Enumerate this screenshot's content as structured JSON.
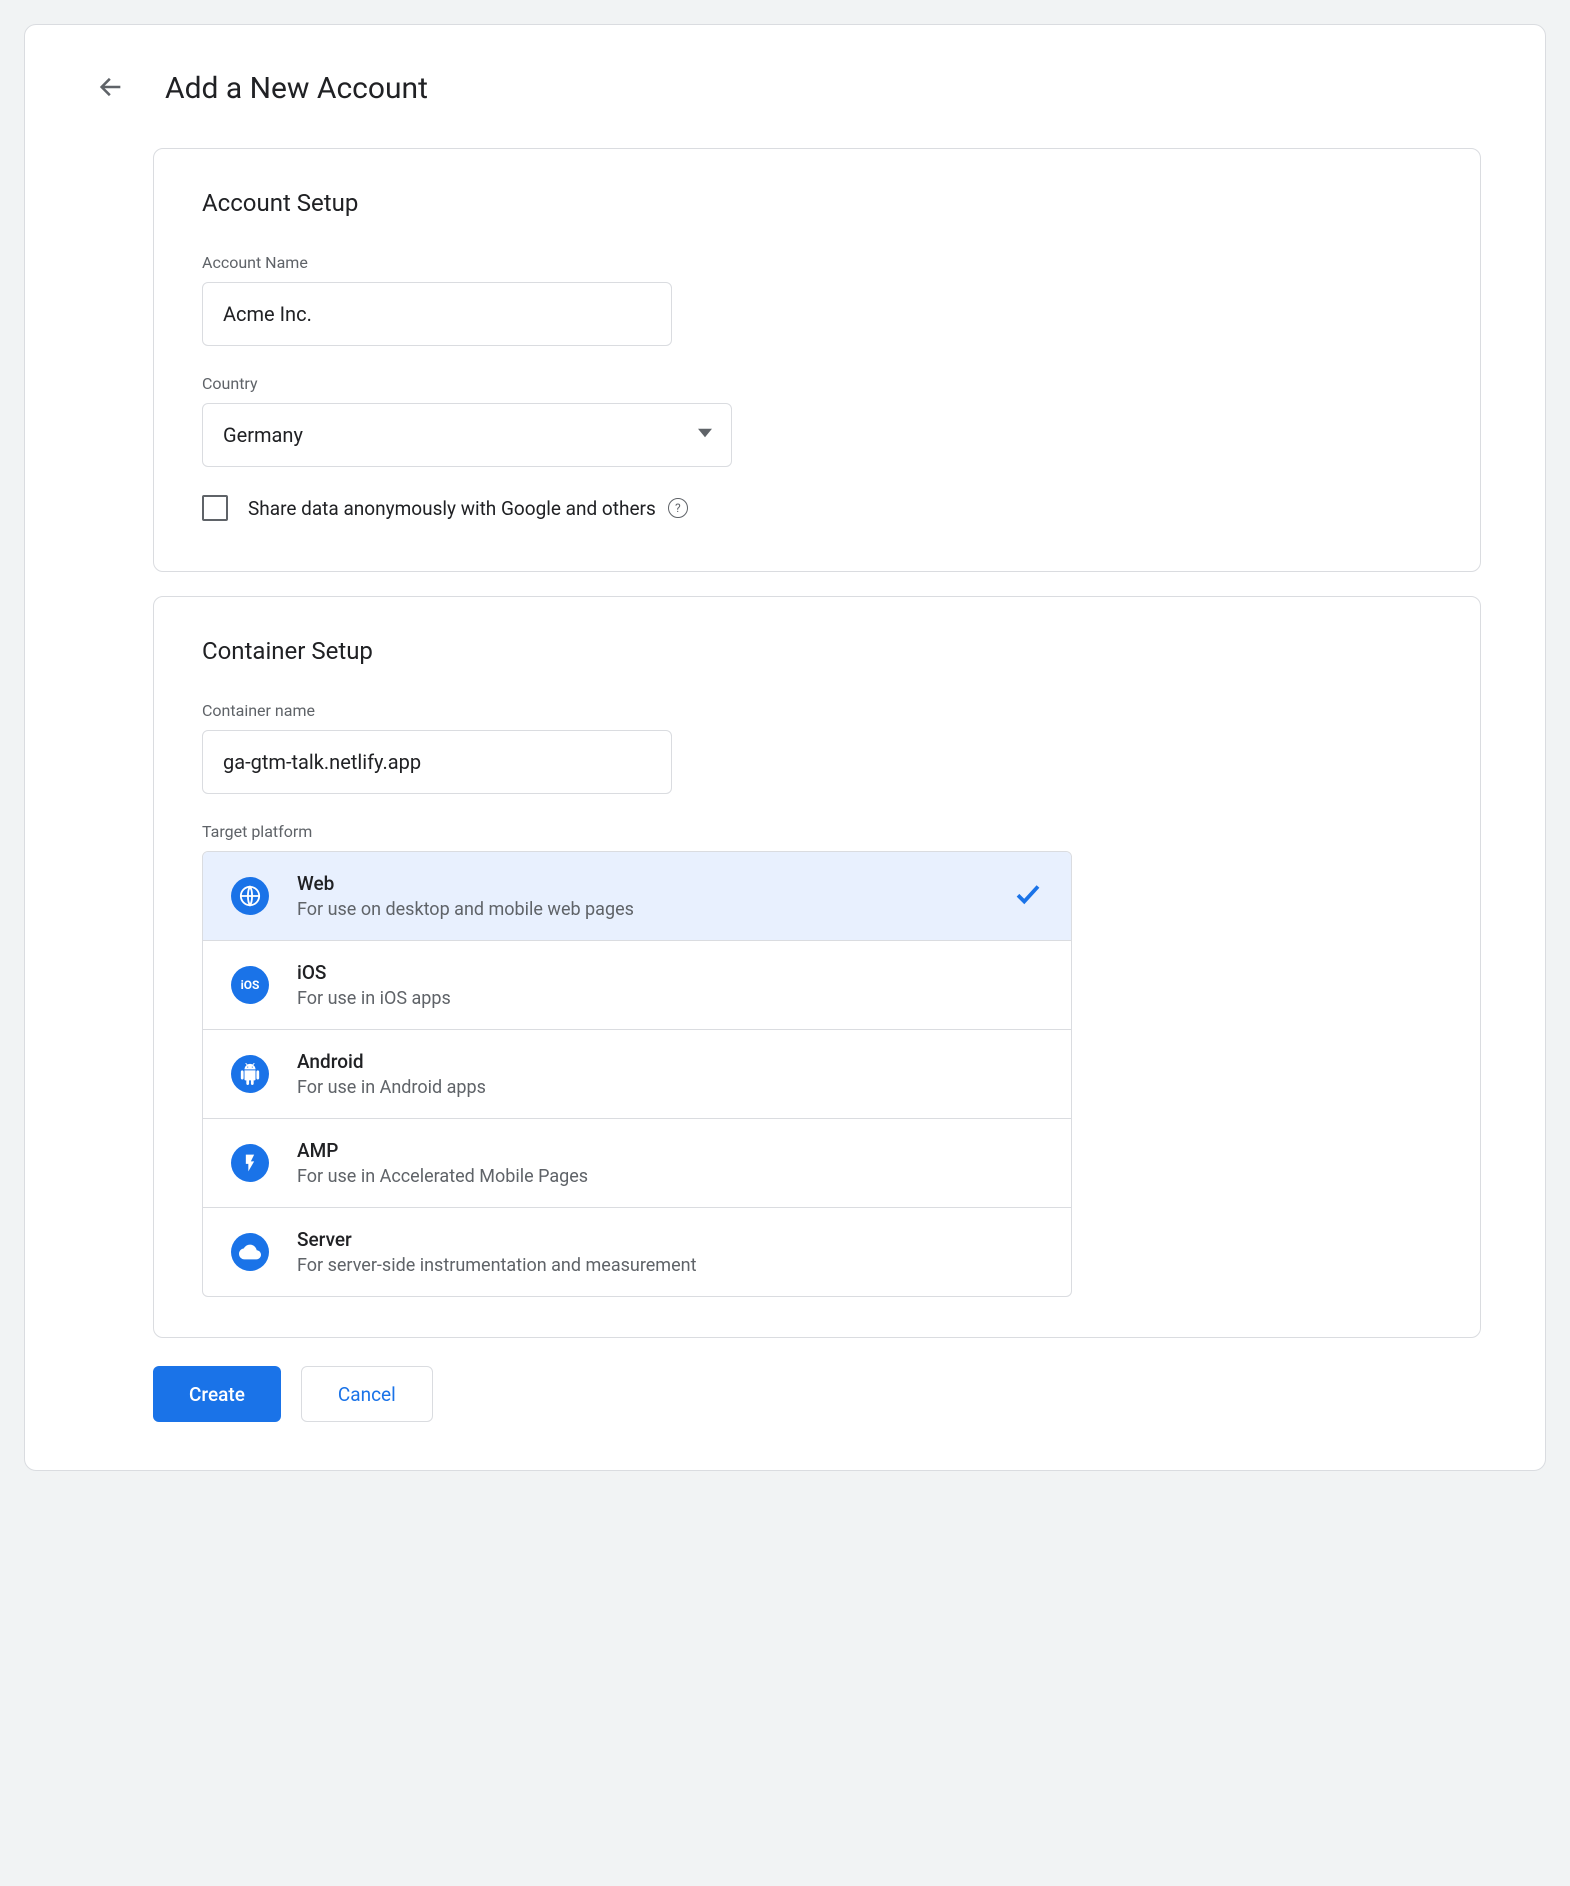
{
  "header": {
    "title": "Add a New Account"
  },
  "account_setup": {
    "heading": "Account Setup",
    "account_name_label": "Account Name",
    "account_name_value": "Acme Inc.",
    "country_label": "Country",
    "country_value": "Germany",
    "share_checkbox_label": "Share data anonymously with Google and others",
    "share_checked": false
  },
  "container_setup": {
    "heading": "Container Setup",
    "container_name_label": "Container name",
    "container_name_value": "ga-gtm-talk.netlify.app",
    "target_platform_label": "Target platform",
    "platforms": [
      {
        "id": "web",
        "title": "Web",
        "desc": "For use on desktop and mobile web pages",
        "selected": true,
        "icon": "globe"
      },
      {
        "id": "ios",
        "title": "iOS",
        "desc": "For use in iOS apps",
        "selected": false,
        "icon": "ios"
      },
      {
        "id": "android",
        "title": "Android",
        "desc": "For use in Android apps",
        "selected": false,
        "icon": "android"
      },
      {
        "id": "amp",
        "title": "AMP",
        "desc": "For use in Accelerated Mobile Pages",
        "selected": false,
        "icon": "bolt"
      },
      {
        "id": "server",
        "title": "Server",
        "desc": "For server-side instrumentation and measurement",
        "selected": false,
        "icon": "cloud"
      }
    ]
  },
  "actions": {
    "create_label": "Create",
    "cancel_label": "Cancel"
  }
}
